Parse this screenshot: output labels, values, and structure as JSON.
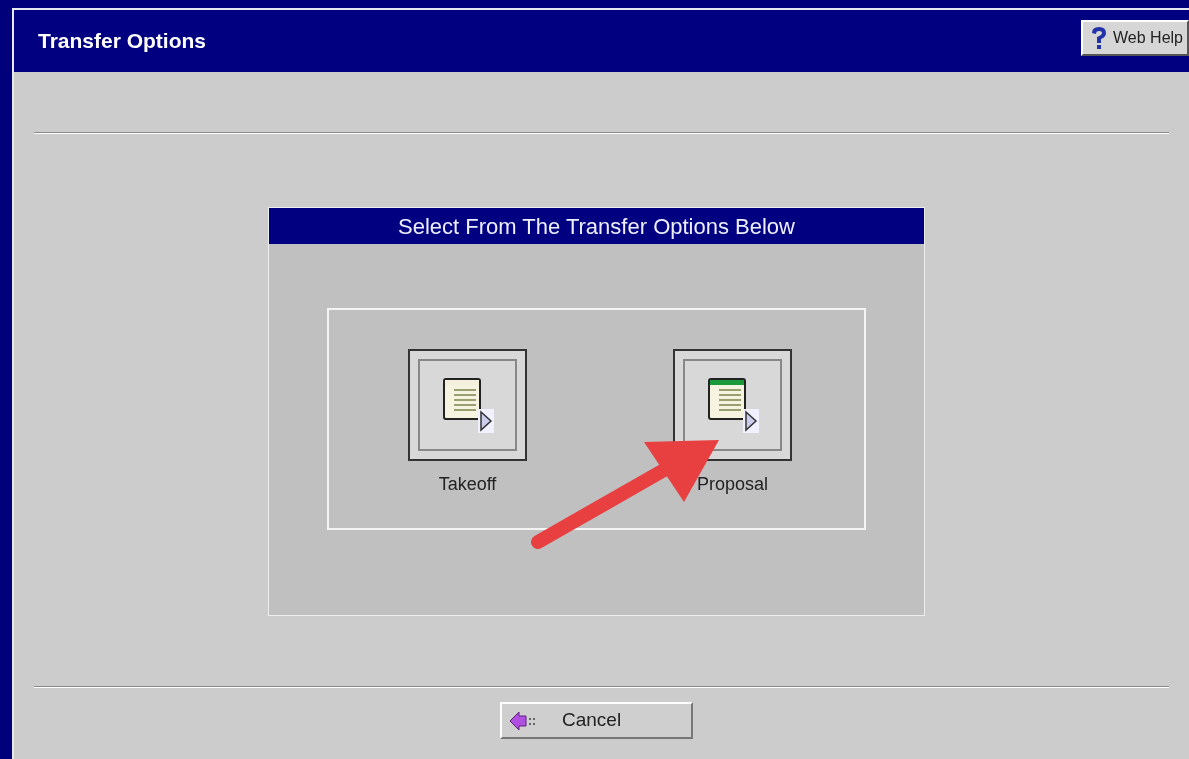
{
  "window": {
    "title": "Transfer Options"
  },
  "help_button": {
    "label": "Web Help"
  },
  "panel": {
    "title": "Select From The Transfer Options Below",
    "options": [
      {
        "label": "Takeoff",
        "kind": "document"
      },
      {
        "label": "Proposal",
        "kind": "spreadsheet"
      }
    ]
  },
  "cancel_button": {
    "label": "Cancel"
  }
}
